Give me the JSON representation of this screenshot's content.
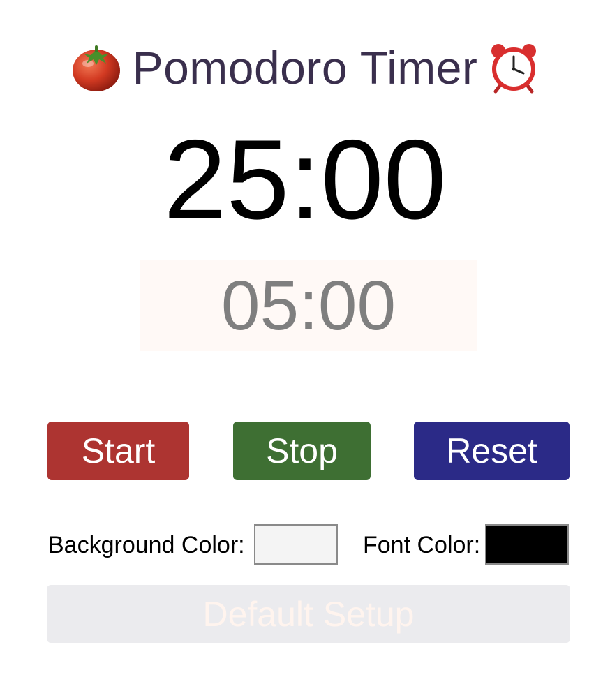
{
  "header": {
    "title": "Pomodoro Timer",
    "left_icon": "tomato-icon",
    "right_icon": "alarm-clock-icon"
  },
  "timer": {
    "work_time": "25:00",
    "break_time": "05:00"
  },
  "controls": {
    "start_label": "Start",
    "stop_label": "Stop",
    "reset_label": "Reset"
  },
  "settings": {
    "background_label": "Background Color:",
    "font_label": "Font Color:",
    "background_color": "#f4f4f4",
    "font_color": "#000000",
    "default_label": "Default Setup"
  },
  "colors": {
    "start": "#ad3431",
    "stop": "#3e6f33",
    "reset": "#2b2a87",
    "title": "#3a2f4d"
  }
}
